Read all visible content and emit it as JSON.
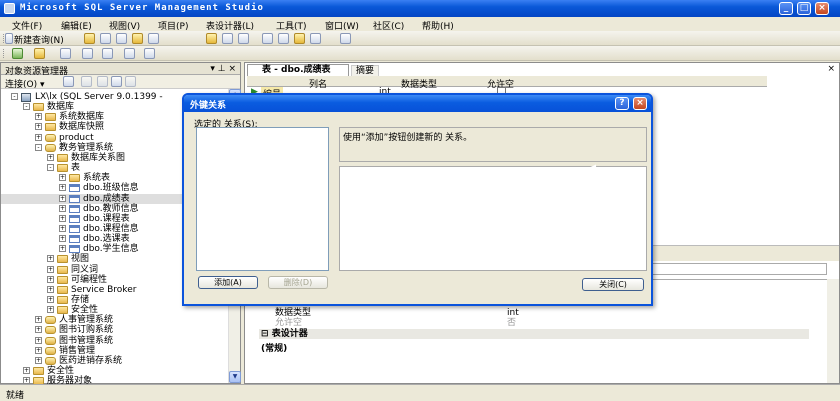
{
  "window": {
    "title": "Microsoft SQL Server Management Studio"
  },
  "menu": [
    "文件(F)",
    "编辑(E)",
    "视图(V)",
    "项目(P)",
    "表设计器(L)",
    "工具(T)",
    "窗口(W)",
    "社区(C)",
    "帮助(H)"
  ],
  "toolbar": {
    "new_query": "新建查询(N)"
  },
  "object_explorer": {
    "title": "对象资源管理器",
    "header_controls": "▾ ⊥ ×",
    "connect_label": "连接(O) ▾",
    "tree": [
      {
        "label": "LX\\lx (SQL Server 9.0.1399 - ",
        "indent": 0,
        "exp": "-",
        "icon": "server"
      },
      {
        "label": "数据库",
        "indent": 1,
        "exp": "-",
        "icon": "folder"
      },
      {
        "label": "系统数据库",
        "indent": 2,
        "exp": "+",
        "icon": "folder"
      },
      {
        "label": "数据库快照",
        "indent": 2,
        "exp": "+",
        "icon": "folder"
      },
      {
        "label": "product",
        "indent": 2,
        "exp": "+",
        "icon": "db"
      },
      {
        "label": "教务管理系统",
        "indent": 2,
        "exp": "-",
        "icon": "db"
      },
      {
        "label": "数据库关系图",
        "indent": 3,
        "exp": "+",
        "icon": "folder"
      },
      {
        "label": "表",
        "indent": 3,
        "exp": "-",
        "icon": "folder"
      },
      {
        "label": "系统表",
        "indent": 4,
        "exp": "+",
        "icon": "folder"
      },
      {
        "label": "dbo.班级信息",
        "indent": 4,
        "exp": "+",
        "icon": "table"
      },
      {
        "label": "dbo.成绩表",
        "indent": 4,
        "exp": "+",
        "icon": "table",
        "selected": true
      },
      {
        "label": "dbo.教师信息",
        "indent": 4,
        "exp": "+",
        "icon": "table"
      },
      {
        "label": "dbo.课程表",
        "indent": 4,
        "exp": "+",
        "icon": "table"
      },
      {
        "label": "dbo.课程信息",
        "indent": 4,
        "exp": "+",
        "icon": "table"
      },
      {
        "label": "dbo.选课表",
        "indent": 4,
        "exp": "+",
        "icon": "table"
      },
      {
        "label": "dbo.学生信息",
        "indent": 4,
        "exp": "+",
        "icon": "table"
      },
      {
        "label": "视图",
        "indent": 3,
        "exp": "+",
        "icon": "folder"
      },
      {
        "label": "同义词",
        "indent": 3,
        "exp": "+",
        "icon": "folder"
      },
      {
        "label": "可编程性",
        "indent": 3,
        "exp": "+",
        "icon": "folder"
      },
      {
        "label": "Service Broker",
        "indent": 3,
        "exp": "+",
        "icon": "folder"
      },
      {
        "label": "存储",
        "indent": 3,
        "exp": "+",
        "icon": "folder"
      },
      {
        "label": "安全性",
        "indent": 3,
        "exp": "+",
        "icon": "folder"
      },
      {
        "label": "人事管理系统",
        "indent": 2,
        "exp": "+",
        "icon": "db"
      },
      {
        "label": "图书订购系统",
        "indent": 2,
        "exp": "+",
        "icon": "db"
      },
      {
        "label": "图书管理系统",
        "indent": 2,
        "exp": "+",
        "icon": "db"
      },
      {
        "label": "销售管理",
        "indent": 2,
        "exp": "+",
        "icon": "db"
      },
      {
        "label": "医药进销存系统",
        "indent": 2,
        "exp": "+",
        "icon": "db"
      },
      {
        "label": "安全性",
        "indent": 1,
        "exp": "+",
        "icon": "folder"
      },
      {
        "label": "服务器对象",
        "indent": 1,
        "exp": "+",
        "icon": "folder"
      },
      {
        "label": "复制",
        "indent": 1,
        "exp": "+",
        "icon": "folder"
      }
    ]
  },
  "document": {
    "tab_title": "表 - dbo.成绩表",
    "tab_summary": "摘要",
    "grid_headers": {
      "name": "列名",
      "type": "数据类型",
      "null": "允许空"
    },
    "grid_row": {
      "name": "编号",
      "type": "int"
    }
  },
  "column_props": {
    "rows": [
      {
        "k": "数据类型",
        "v": "int",
        "cat": false
      },
      {
        "k": "允许空",
        "v": "否",
        "cat": false,
        "dim": true
      },
      {
        "k": "表设计器",
        "v": "",
        "cat": true
      }
    ],
    "general": "(常规)"
  },
  "dialog": {
    "title": "外键关系",
    "selected_label": "选定的 关系(S):",
    "hint": "使用“添加”按钮创建新的 关系。",
    "add_button": "添加(A)",
    "delete_button": "删除(D)",
    "close_button": "关闭(C)"
  },
  "status": {
    "text": "就绪"
  }
}
